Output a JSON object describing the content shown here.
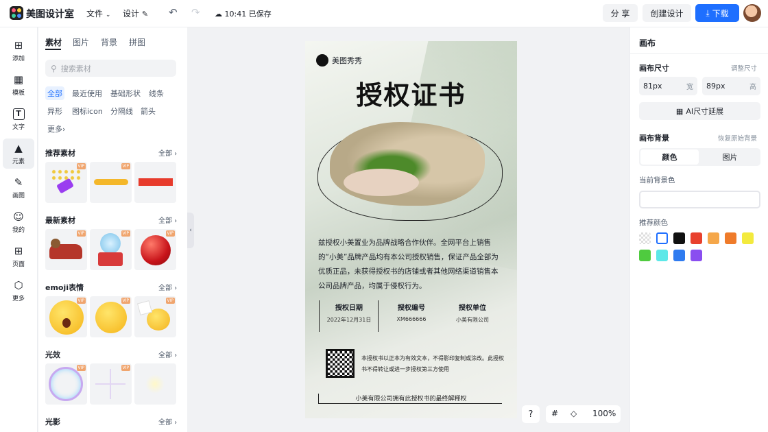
{
  "topbar": {
    "app_title": "美图设计室",
    "menu_file": "文件",
    "menu_design": "设计",
    "save_status": "10:41 已保存",
    "share": "分 享",
    "create_design": "创建设计",
    "download": "下载"
  },
  "rail": {
    "items": [
      {
        "label": "添加",
        "icon": "plus-square-icon"
      },
      {
        "label": "模板",
        "icon": "template-icon"
      },
      {
        "label": "文字",
        "icon": "text-icon"
      },
      {
        "label": "元素",
        "icon": "shapes-icon"
      },
      {
        "label": "画图",
        "icon": "edit-icon"
      },
      {
        "label": "我的",
        "icon": "user-icon"
      },
      {
        "label": "页面",
        "icon": "page-add-icon"
      },
      {
        "label": "更多",
        "icon": "cube-icon"
      }
    ],
    "active_index": 3
  },
  "assets": {
    "tabs": [
      "素材",
      "图片",
      "背景",
      "拼图"
    ],
    "search_placeholder": "搜索素材",
    "chips": [
      "全部",
      "最近使用",
      "基础形状",
      "线条",
      "异形",
      "图标icon",
      "分隔线",
      "箭头",
      "更多"
    ],
    "see_all": "全部",
    "vip": "VIP",
    "sections": [
      "推荐素材",
      "最新素材",
      "emoji表情",
      "光效",
      "光影"
    ]
  },
  "canvas": {
    "brand": "美图秀秀",
    "title": "授权证书",
    "body": "兹授权小美置业为品牌战略合作伙伴。全网平台上销售的“小美”品牌产品均有本公司授权销售，保证产品全部为优质正品，未获得授权书的店铺或者其他网络渠道销售本公司品牌产品，均属于侵权行为。",
    "info": [
      {
        "head": "授权日期",
        "value": "2022年12月31日"
      },
      {
        "head": "授权编号",
        "value": "XM666666"
      },
      {
        "head": "授权单位",
        "value": "小美有限公司"
      }
    ],
    "qr_text": "本授权书以正本为有效文本，不得影印复制或涂改。此授权书不得转让或进一步授权第三方使用",
    "footer": "小美有限公司拥有此授权书的最终解释权",
    "help": "?",
    "zoom": "100%"
  },
  "right_panel": {
    "title": "画布",
    "size_label": "画布尺寸",
    "adjust_size": "调整尺寸",
    "width_value": "81px",
    "width_unit": "宽",
    "height_value": "89px",
    "height_unit": "高",
    "ai_extend": "AI尺寸延展",
    "bg_label": "画布背景",
    "restore_bg": "恢复原始背景",
    "seg_color": "颜色",
    "seg_image": "图片",
    "current_bg_label": "当前背景色",
    "recommend_label": "推荐颜色",
    "colors": [
      "transparent",
      "#ffffff",
      "#111111",
      "#e8412e",
      "#f5a74a",
      "#ef7b2a",
      "#f3ea3e",
      "#4fcb3f",
      "#5ce8e8",
      "#2f7bf0",
      "#8a4ef0"
    ]
  }
}
